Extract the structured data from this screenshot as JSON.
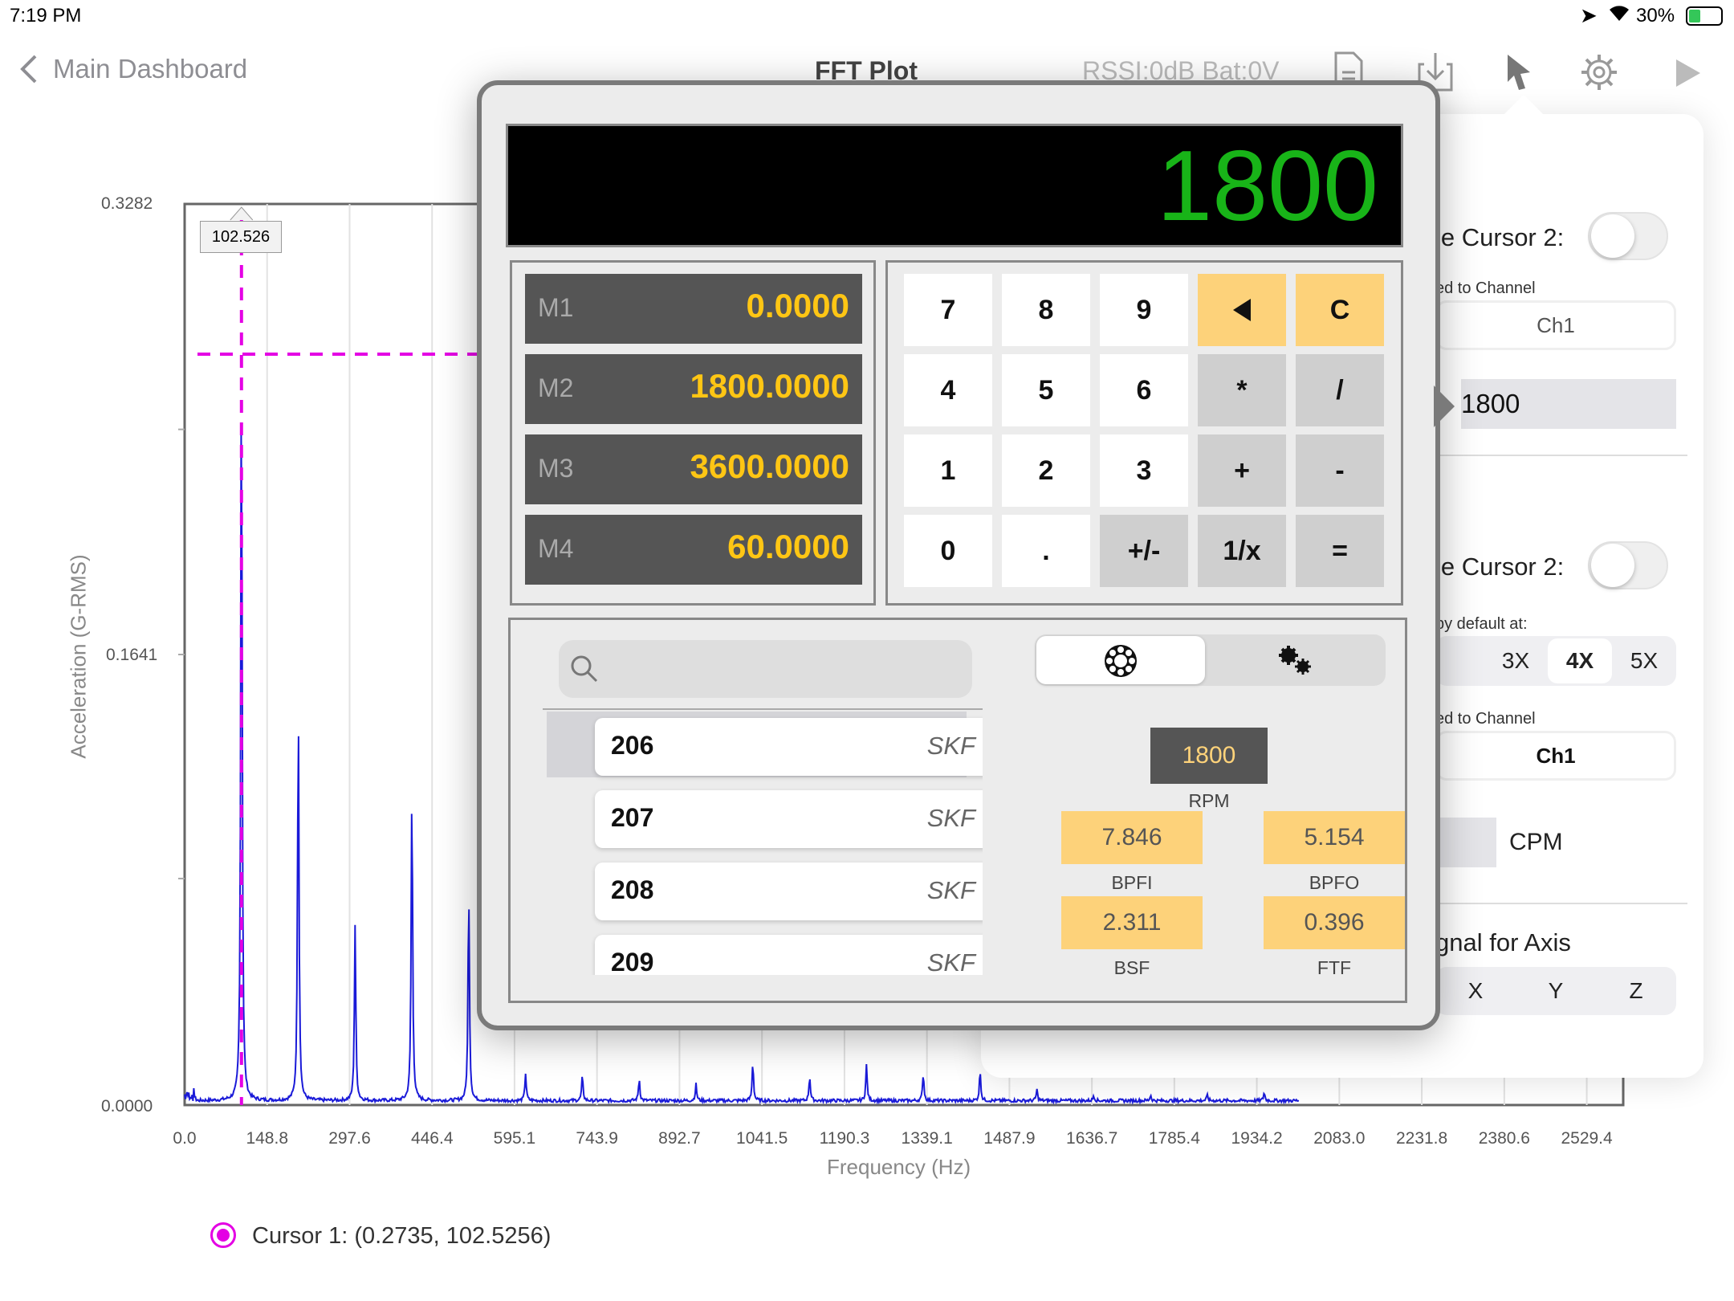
{
  "status": {
    "time": "7:19 PM",
    "battery": "30%"
  },
  "nav": {
    "back_label": "Main Dashboard",
    "title": "FFT Plot",
    "meta": "RSSI:0dB  Bat:0V"
  },
  "chart_data": {
    "type": "line",
    "xlabel": "Frequency (Hz)",
    "ylabel": "Acceleration (G-RMS)",
    "xlim": [
      0.0,
      2529.4
    ],
    "ylim": [
      0.0,
      0.3282
    ],
    "x_ticks": [
      "0.0",
      "148.8",
      "297.6",
      "446.4",
      "595.1",
      "743.9",
      "892.7",
      "1041.5",
      "1190.3",
      "1339.1",
      "1487.9",
      "1636.7",
      "1785.4",
      "1934.2",
      "2083.0",
      "2231.8",
      "2380.6",
      "2529.4"
    ],
    "y_ticks": [
      "0.0000",
      "0.1641",
      "0.3282"
    ],
    "cursor_tooltip": "102.526",
    "peaks": [
      {
        "x": 102.5,
        "y": 0.2735
      },
      {
        "x": 205,
        "y": 0.148
      },
      {
        "x": 307.5,
        "y": 0.064
      },
      {
        "x": 410,
        "y": 0.116
      },
      {
        "x": 512.5,
        "y": 0.078
      },
      {
        "x": 615,
        "y": 0.01
      },
      {
        "x": 717.5,
        "y": 0.009
      },
      {
        "x": 820,
        "y": 0.008
      },
      {
        "x": 922.5,
        "y": 0.006
      },
      {
        "x": 1025,
        "y": 0.014
      },
      {
        "x": 1127.5,
        "y": 0.009
      },
      {
        "x": 1230,
        "y": 0.013
      },
      {
        "x": 1332.5,
        "y": 0.01
      },
      {
        "x": 1435,
        "y": 0.011
      },
      {
        "x": 1537.5,
        "y": 0.004
      },
      {
        "x": 1640,
        "y": 0.002
      },
      {
        "x": 1742.5,
        "y": 0.002
      },
      {
        "x": 1845,
        "y": 0.002
      },
      {
        "x": 1947.5,
        "y": 0.003
      }
    ],
    "cursor": {
      "x": 102.526,
      "y": 0.2735
    }
  },
  "legend": {
    "cursor1": "Cursor 1: (0.2735, 102.5256)"
  },
  "settings": {
    "cursor2_label_a": "le Cursor 2:",
    "linked_channel_a": "ed to Channel",
    "channel_a": "Ch1",
    "rpm_field": "1800",
    "cursor2_label_b": "le Cursor 2:",
    "default_at": "by default at:",
    "harmonics": [
      "3X",
      "4X",
      "5X"
    ],
    "linked_channel_b": "ed to Channel",
    "channel_b": "Ch1",
    "cpm": "CPM",
    "signal_axis": "gnal for Axis",
    "axes": [
      "X",
      "Y",
      "Z"
    ]
  },
  "calculator": {
    "display": "1800",
    "memory": [
      {
        "label": "M1",
        "value": "0.0000"
      },
      {
        "label": "M2",
        "value": "1800.0000"
      },
      {
        "label": "M3",
        "value": "3600.0000"
      },
      {
        "label": "M4",
        "value": "60.0000"
      }
    ],
    "keys": [
      "7",
      "8",
      "9",
      "◀",
      "C",
      "4",
      "5",
      "6",
      "*",
      "/",
      "1",
      "2",
      "3",
      "+",
      "-",
      "0",
      ".",
      "+/-",
      "1/x",
      "="
    ],
    "bearings": [
      {
        "number": "206",
        "brand": "SKF"
      },
      {
        "number": "207",
        "brand": "SKF"
      },
      {
        "number": "208",
        "brand": "SKF"
      },
      {
        "number": "209",
        "brand": "SKF"
      }
    ],
    "rpm_value": "1800",
    "rpm_label": "RPM",
    "freqs": [
      {
        "value": "7.846",
        "label": "BPFI"
      },
      {
        "value": "5.154",
        "label": "BPFO"
      },
      {
        "value": "2.311",
        "label": "BSF"
      },
      {
        "value": "0.396",
        "label": "FTF"
      }
    ]
  }
}
